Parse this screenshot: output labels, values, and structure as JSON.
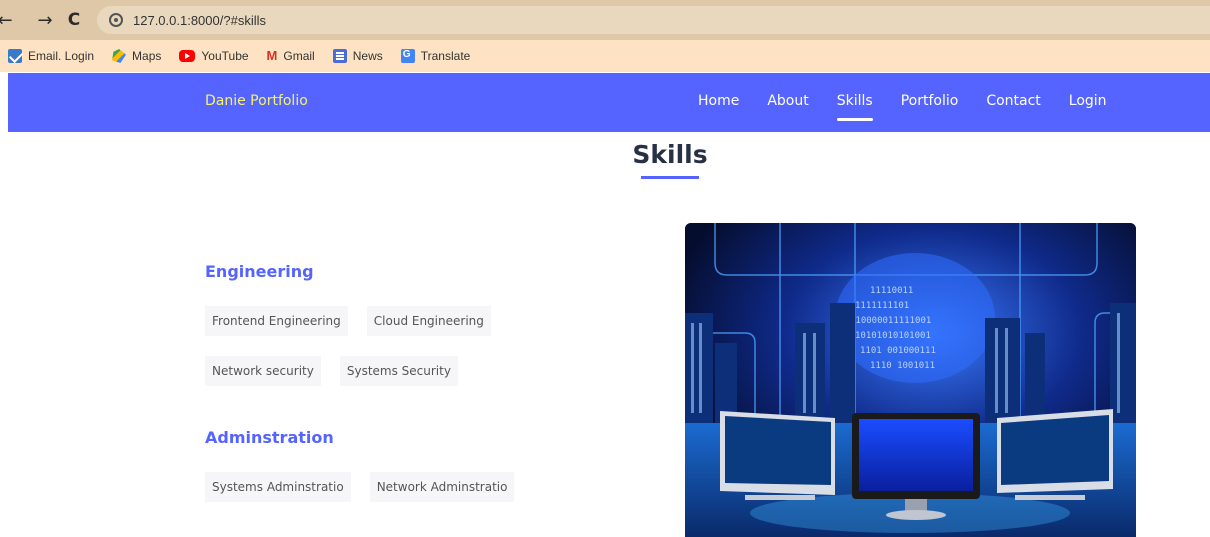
{
  "browser": {
    "back_glyph": "←",
    "forward_glyph": "→",
    "reload_glyph": "C",
    "url": "127.0.0.1:8000/?#skills",
    "bookmarks": [
      {
        "label": "Email. Login",
        "icon": "email-icon"
      },
      {
        "label": "Maps",
        "icon": "maps-icon"
      },
      {
        "label": "YouTube",
        "icon": "youtube-icon"
      },
      {
        "label": "Gmail",
        "icon": "gmail-icon"
      },
      {
        "label": "News",
        "icon": "news-icon"
      },
      {
        "label": "Translate",
        "icon": "translate-icon"
      }
    ],
    "chrome_color": "#dfc8a8",
    "bookmarks_bar_color": "#fde3c3"
  },
  "navbar": {
    "brand": "Danie Portfolio",
    "links": [
      "Home",
      "About",
      "Skills",
      "Portfolio",
      "Contact",
      "Login"
    ],
    "active": "Skills",
    "bg_color": "#5664ff",
    "brand_color": "#f4f46b"
  },
  "section": {
    "title": "Skills",
    "accent_color": "#5664ff"
  },
  "skills": {
    "engineering": {
      "title": "Engineering",
      "tags_row1": [
        "Frontend Engineering",
        "Cloud Engineering"
      ],
      "tags_row2": [
        "Network security",
        "Systems Security"
      ]
    },
    "administration": {
      "title": "Adminstration",
      "tags_row1": [
        "Systems Adminstratio",
        "Network Adminstratio"
      ]
    }
  },
  "illustration": {
    "subject": "computer monitors in front of a digital city skyline with binary globe"
  }
}
